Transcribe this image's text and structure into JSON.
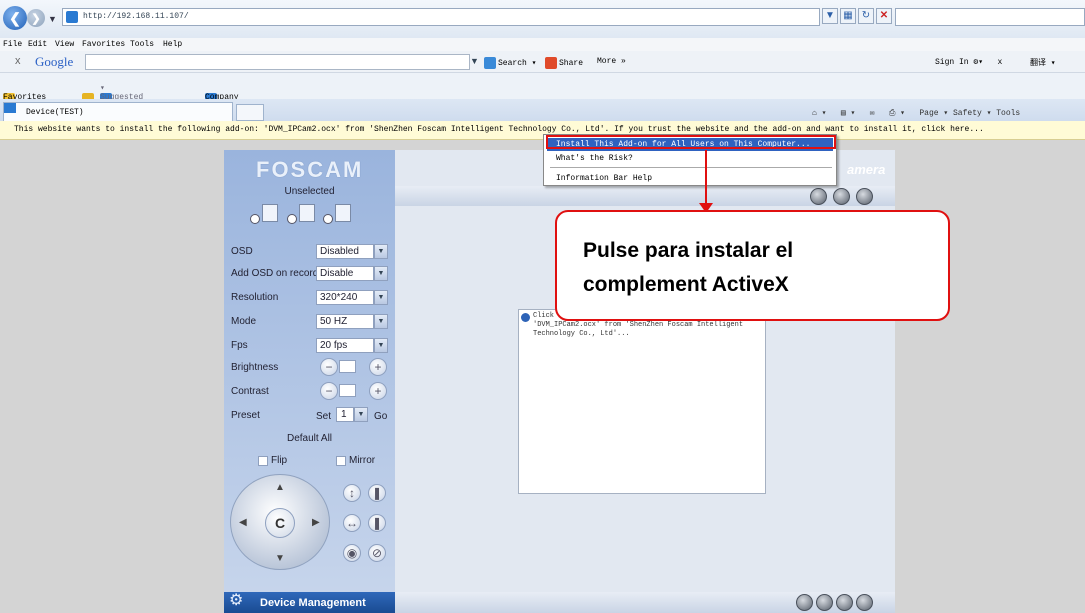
{
  "browser": {
    "url": "http://192.168.11.107/",
    "menu": [
      "File",
      "Edit",
      "View",
      "Favorites",
      "Tools",
      "Help"
    ],
    "google_toolbar": {
      "close": "x",
      "logo": "Google",
      "search_btn": "Search",
      "share_btn": "Share",
      "more_btn": "More »",
      "sign_in": "Sign In",
      "x2": "x",
      "translate": "翻译"
    },
    "favorites_bar": {
      "favorites": "Favorites",
      "suggested": "Suggested Sites",
      "company_mail": "Company Mailbox"
    },
    "tab_title": "Device(TEST)",
    "command_bar": "Page ▾  Safety ▾  Tools",
    "info_bar": "This website wants to install the following add-on: 'DVM_IPCam2.ocx' from 'ShenZhen Foscam Intelligent Technology Co., Ltd'. If you trust the website and the add-on and want to install it, click here...",
    "context_menu": {
      "item1": "Install This Add-on for All Users on This Computer...",
      "item2": "What's the Risk?",
      "item3": "Information Bar Help"
    }
  },
  "camera_app": {
    "logo": "FOSCAM",
    "camera_title": "amera",
    "unselected": "Unselected",
    "settings": [
      {
        "label": "OSD",
        "value": "Disabled"
      },
      {
        "label": "Add OSD on record",
        "value": "Disable"
      },
      {
        "label": "Resolution",
        "value": "320*240"
      },
      {
        "label": "Mode",
        "value": "50 HZ"
      },
      {
        "label": "Fps",
        "value": "20 fps"
      }
    ],
    "brightness_label": "Brightness",
    "contrast_label": "Contrast",
    "preset_label": "Preset",
    "preset_set": "Set",
    "preset_value": "1",
    "preset_go": "Go",
    "default_all": "Default All",
    "flip_label": "Flip",
    "mirror_label": "Mirror",
    "ptz_center": "C",
    "device_management": "Device Management",
    "video_message": "Click here to install the following ActiveX control: 'DVM_IPCam2.ocx' from 'ShenZhen Foscam Intelligent Technology Co., Ltd'..."
  },
  "callout": {
    "line1": "Pulse para instalar el",
    "line2": "complement ActiveX"
  },
  "colors": {
    "highlight_red": "#e01010",
    "menu_selected": "#2f62c0",
    "device_mgmt_bar": "#1a4b92"
  }
}
